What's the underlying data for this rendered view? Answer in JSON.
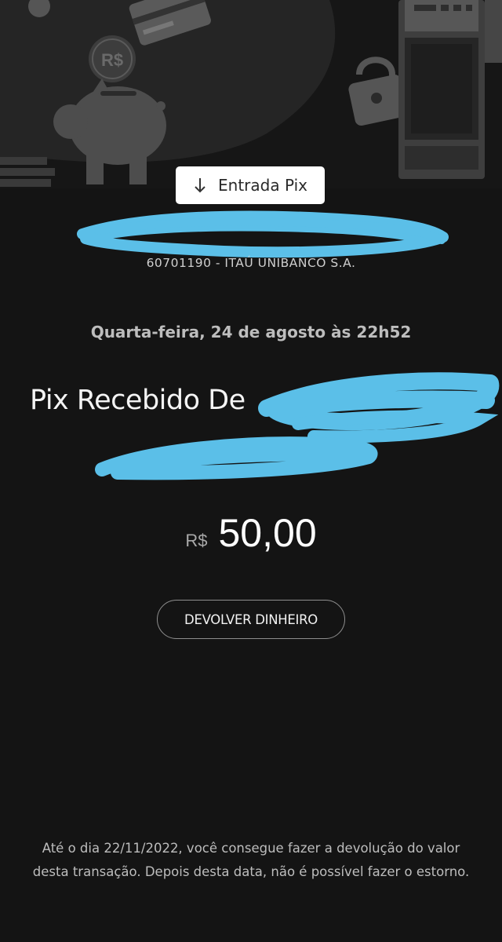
{
  "header": {
    "badge_label": "Entrada Pix",
    "badge_icon": "arrow-down-icon",
    "coin_symbol": "R$"
  },
  "transaction": {
    "bank_line": "60701190 - ITAÚ UNIBANCO S.A.",
    "date_line": "Quarta-feira, 24 de agosto às 22h52",
    "title": "Pix Recebido De",
    "currency": "R$",
    "amount": "50,00"
  },
  "actions": {
    "return_money_label": "DEVOLVER DINHEIRO"
  },
  "footer": {
    "note": "Até o dia 22/11/2022, você consegue fazer a devolução do valor desta transação. Depois desta data, não é possível fazer o estorno."
  },
  "colors": {
    "background": "#141414",
    "redaction_scribble": "#5bbfe8",
    "illustration": "#4a4a4a"
  }
}
